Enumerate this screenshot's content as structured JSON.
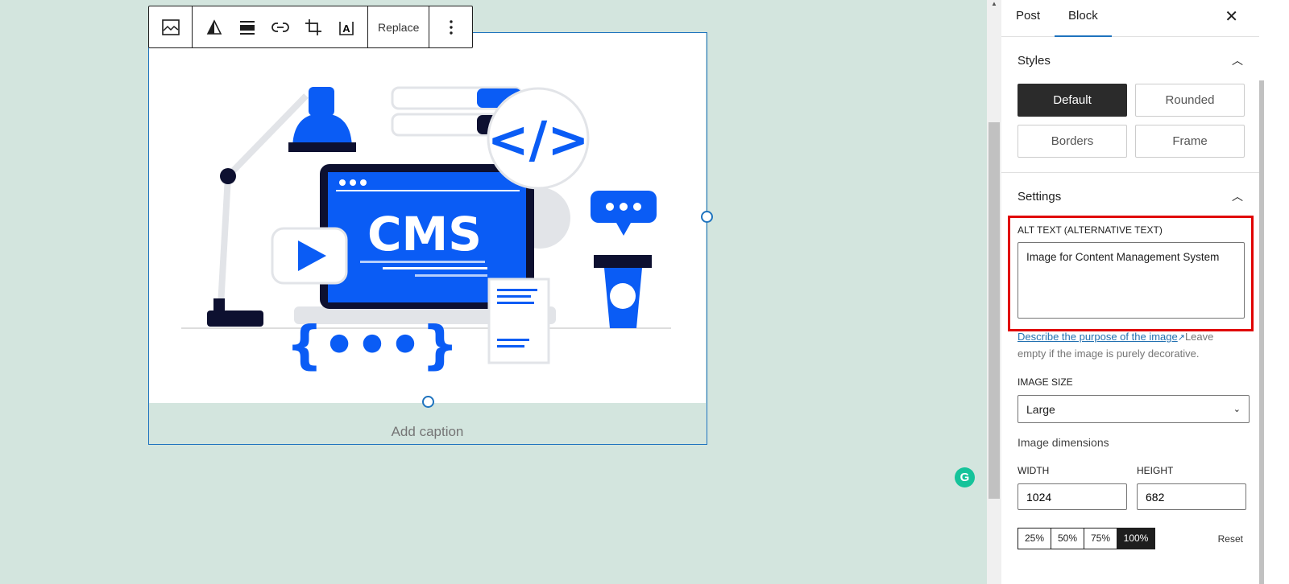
{
  "toolbar": {
    "buttons": [
      {
        "icon": "image-icon"
      },
      {
        "icon": "duotone-icon"
      },
      {
        "icon": "align-icon"
      },
      {
        "icon": "link-icon"
      },
      {
        "icon": "crop-icon"
      },
      {
        "icon": "text-overlay-icon"
      }
    ],
    "replace_label": "Replace",
    "more_icon": "more-vertical-icon"
  },
  "image": {
    "illustration_text": "CMS",
    "caption_placeholder": "Add caption"
  },
  "colors": {
    "accent": "#1e73be",
    "illustration_blue": "#0a5cf5",
    "highlight": "#e00000",
    "background": "#d3e5de"
  },
  "sidebar": {
    "tabs": [
      {
        "label": "Post"
      },
      {
        "label": "Block"
      }
    ],
    "styles": {
      "title": "Styles",
      "options": [
        "Default",
        "Rounded",
        "Borders",
        "Frame"
      ],
      "selected": "Default"
    },
    "settings": {
      "title": "Settings",
      "alt_label": "ALT TEXT (ALTERNATIVE TEXT)",
      "alt_value": "Image for Content Management System",
      "help_link": "Describe the purpose of the image",
      "help_text": "Leave empty if the image is purely decorative.",
      "size_label": "IMAGE SIZE",
      "size_value": "Large",
      "dimensions_label": "Image dimensions",
      "width_label": "WIDTH",
      "width_value": "1024",
      "height_label": "HEIGHT",
      "height_value": "682",
      "percents": [
        "25%",
        "50%",
        "75%",
        "100%"
      ],
      "selected_percent": "100%",
      "reset_label": "Reset"
    }
  },
  "grammarly": {
    "letter": "G"
  }
}
